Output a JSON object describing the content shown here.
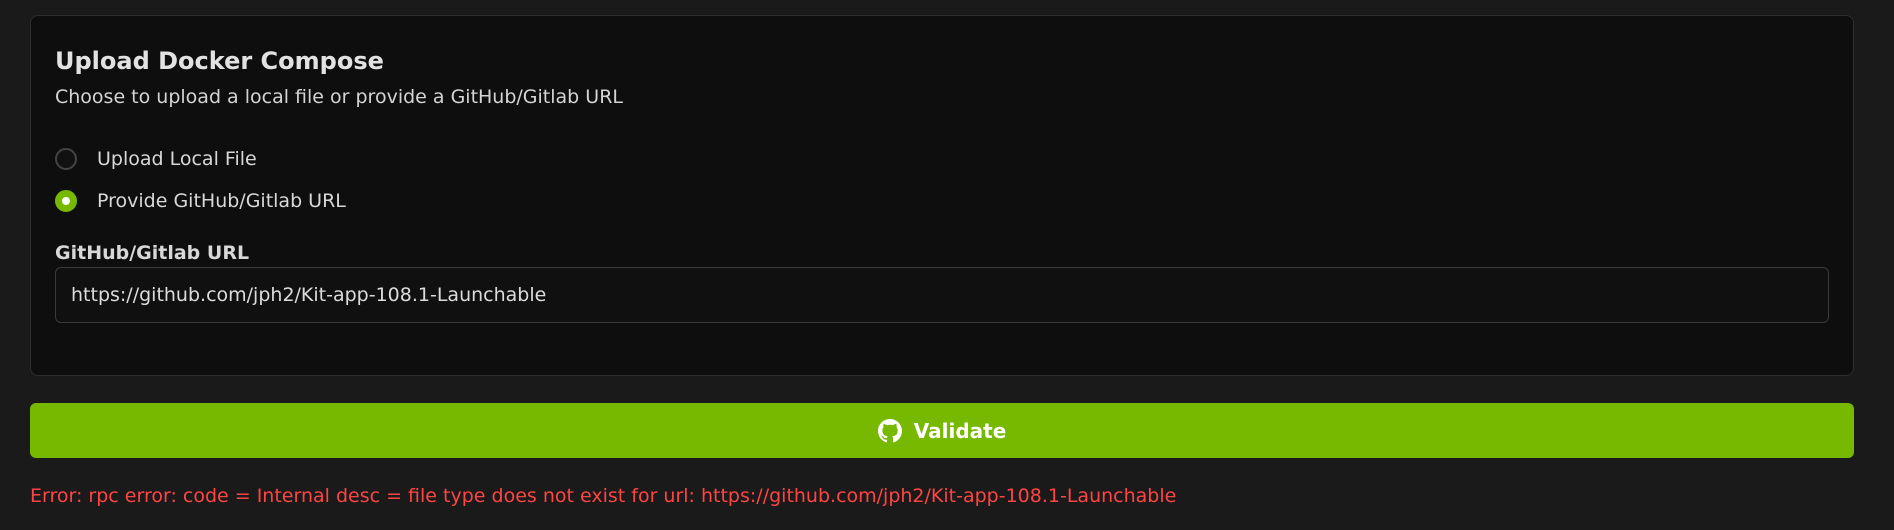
{
  "upload": {
    "title": "Upload Docker Compose",
    "subtitle": "Choose to upload a local file or provide a GitHub/Gitlab URL",
    "options": [
      {
        "label": "Upload Local File",
        "selected": false
      },
      {
        "label": "Provide GitHub/Gitlab URL",
        "selected": true
      }
    ],
    "url_label": "GitHub/Gitlab URL",
    "url_value": "https://github.com/jph2/Kit-app-108.1-Launchable"
  },
  "validate_button": {
    "label": "Validate",
    "icon": "github-icon"
  },
  "error_message": "Error: rpc error: code = Internal desc = file type does not exist for url: https://github.com/jph2/Kit-app-108.1-Launchable",
  "colors": {
    "accent": "#76b900",
    "error": "#ff4444",
    "background": "#1a1a1a",
    "card": "#0e0e0e"
  }
}
